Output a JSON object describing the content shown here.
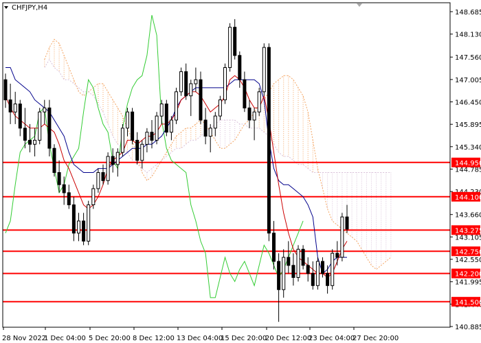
{
  "symbol": {
    "label": "CHFJPY,H4"
  },
  "colors": {
    "bull": "#000000",
    "bear": "#000000",
    "tenkan": "#cc0000",
    "kijun": "#00008b",
    "chikou": "#33cc33",
    "span_a": "#f4a460",
    "span_b": "#d8bfd8",
    "level": "#ff0000",
    "level_label_bg": "#ff0000",
    "axis": "#000000"
  },
  "chart_data": {
    "type": "candlestick",
    "title": "CHFJPY,H4",
    "x_tick_labels": [
      "28 Nov 2022",
      "1 Dec 04:00",
      "5 Dec 20:00",
      "8 Dec 12:00",
      "13 Dec 04:00",
      "15 Dec 20:00",
      "20 Dec 12:00",
      "23 Dec 04:00",
      "27 Dec 20:00"
    ],
    "y_tick_labels": [
      "148.685",
      "148.130",
      "147.560",
      "147.005",
      "146.450",
      "145.895",
      "145.340",
      "144.785",
      "144.230",
      "143.660",
      "143.105",
      "142.550",
      "141.995",
      "141.440",
      "140.885"
    ],
    "ylim": [
      140.885,
      148.685
    ],
    "horizontal_levels": [
      144.95,
      144.1,
      143.275,
      142.75,
      142.2,
      141.5
    ],
    "level_labels": [
      "144.950",
      "144.100",
      "143.275",
      "142.750",
      "142.200",
      "141.500"
    ],
    "current_price_label": "143.275",
    "ohlc": [
      [
        147.0,
        147.15,
        146.3,
        146.5
      ],
      [
        146.5,
        146.9,
        145.9,
        146.2
      ],
      [
        146.2,
        146.7,
        145.9,
        146.4
      ],
      [
        146.4,
        146.5,
        145.6,
        145.8
      ],
      [
        145.8,
        146.3,
        145.3,
        145.5
      ],
      [
        145.5,
        145.9,
        145.2,
        145.4
      ],
      [
        145.4,
        145.8,
        145.1,
        145.5
      ],
      [
        145.5,
        146.3,
        145.4,
        146.2
      ],
      [
        146.2,
        146.5,
        145.9,
        146.3
      ],
      [
        146.3,
        146.5,
        145.1,
        145.3
      ],
      [
        145.3,
        145.4,
        144.6,
        144.7
      ],
      [
        144.7,
        145.0,
        144.2,
        144.4
      ],
      [
        144.4,
        144.6,
        143.9,
        144.2
      ],
      [
        144.2,
        144.4,
        143.8,
        143.9
      ],
      [
        143.9,
        144.1,
        143.0,
        143.2
      ],
      [
        143.2,
        143.7,
        143.0,
        143.5
      ],
      [
        143.5,
        143.7,
        142.9,
        143.0
      ],
      [
        143.0,
        144.0,
        142.9,
        143.9
      ],
      [
        143.9,
        144.4,
        143.8,
        144.3
      ],
      [
        144.3,
        144.8,
        144.2,
        144.7
      ],
      [
        144.7,
        144.9,
        144.4,
        144.5
      ],
      [
        144.5,
        145.2,
        144.4,
        145.1
      ],
      [
        145.1,
        145.3,
        144.7,
        144.9
      ],
      [
        144.9,
        145.3,
        144.6,
        145.2
      ],
      [
        145.2,
        145.9,
        145.1,
        145.8
      ],
      [
        145.8,
        146.3,
        145.6,
        146.2
      ],
      [
        146.2,
        146.3,
        145.4,
        145.5
      ],
      [
        145.5,
        145.7,
        144.9,
        145.0
      ],
      [
        145.0,
        145.5,
        144.8,
        145.4
      ],
      [
        145.4,
        145.8,
        145.2,
        145.7
      ],
      [
        145.7,
        146.0,
        145.3,
        145.5
      ],
      [
        145.5,
        146.2,
        145.4,
        146.1
      ],
      [
        146.1,
        146.5,
        145.9,
        146.4
      ],
      [
        146.4,
        146.5,
        145.6,
        145.7
      ],
      [
        145.7,
        146.1,
        145.5,
        146.0
      ],
      [
        146.0,
        146.8,
        145.9,
        146.7
      ],
      [
        146.7,
        147.3,
        146.6,
        147.2
      ],
      [
        147.2,
        147.4,
        146.5,
        146.6
      ],
      [
        146.6,
        147.0,
        146.1,
        146.9
      ],
      [
        146.9,
        147.3,
        146.7,
        147.0
      ],
      [
        147.0,
        147.2,
        145.9,
        146.0
      ],
      [
        146.0,
        146.3,
        145.4,
        145.6
      ],
      [
        145.6,
        145.9,
        145.2,
        145.8
      ],
      [
        145.8,
        146.2,
        145.6,
        146.1
      ],
      [
        146.1,
        146.6,
        146.0,
        146.5
      ],
      [
        146.5,
        147.4,
        146.4,
        147.3
      ],
      [
        147.3,
        148.4,
        147.2,
        148.3
      ],
      [
        148.3,
        148.5,
        147.5,
        147.6
      ],
      [
        147.6,
        147.7,
        146.8,
        147.0
      ],
      [
        147.0,
        147.2,
        146.2,
        146.3
      ],
      [
        146.3,
        146.5,
        145.8,
        146.0
      ],
      [
        146.0,
        146.3,
        145.5,
        146.2
      ],
      [
        146.2,
        146.8,
        146.1,
        146.7
      ],
      [
        146.7,
        147.9,
        146.6,
        147.8
      ],
      [
        147.8,
        147.9,
        143.0,
        143.2
      ],
      [
        143.2,
        143.5,
        142.3,
        142.5
      ],
      [
        142.5,
        142.7,
        141.0,
        141.8
      ],
      [
        141.8,
        142.8,
        141.6,
        142.6
      ],
      [
        142.6,
        143.0,
        142.2,
        142.4
      ],
      [
        142.4,
        142.7,
        141.9,
        142.1
      ],
      [
        142.1,
        142.9,
        142.0,
        142.8
      ],
      [
        142.8,
        142.9,
        142.3,
        142.4
      ],
      [
        142.4,
        142.6,
        142.0,
        142.2
      ],
      [
        142.2,
        142.5,
        141.8,
        141.9
      ],
      [
        141.9,
        142.6,
        141.8,
        142.5
      ],
      [
        142.5,
        142.6,
        142.1,
        142.2
      ],
      [
        142.2,
        142.4,
        141.7,
        141.9
      ],
      [
        141.9,
        142.8,
        141.8,
        142.7
      ],
      [
        142.7,
        143.0,
        142.4,
        142.6
      ],
      [
        142.6,
        143.7,
        142.5,
        143.6
      ],
      [
        143.6,
        143.9,
        143.2,
        143.3
      ]
    ],
    "tenkan": [
      146.6,
      146.3,
      146.1,
      146.0,
      145.9,
      145.8,
      145.8,
      145.8,
      145.9,
      145.8,
      145.7,
      145.4,
      145.0,
      144.8,
      144.5,
      144.2,
      143.9,
      143.8,
      143.9,
      144.1,
      144.4,
      144.8,
      145.0,
      145.1,
      145.2,
      145.5,
      145.5,
      145.4,
      145.5,
      145.6,
      145.6,
      145.7,
      145.9,
      145.9,
      146.0,
      146.2,
      146.5,
      146.6,
      146.7,
      146.7,
      146.6,
      146.4,
      146.2,
      146.3,
      146.4,
      146.6,
      147.0,
      147.1,
      147.0,
      146.8,
      146.5,
      146.3,
      146.3,
      146.6,
      146.0,
      145.2,
      144.4,
      143.7,
      143.2,
      142.8,
      142.6,
      142.5,
      142.4,
      142.3,
      142.2,
      142.2,
      142.1,
      142.2,
      142.5,
      142.8,
      143.0
    ],
    "kijun": [
      147.3,
      147.3,
      147.0,
      146.9,
      146.8,
      146.7,
      146.5,
      146.4,
      146.3,
      146.2,
      146.0,
      145.8,
      145.6,
      145.2,
      144.9,
      144.8,
      144.7,
      144.7,
      144.7,
      144.8,
      144.8,
      144.8,
      144.9,
      145.0,
      145.1,
      145.2,
      145.3,
      145.3,
      145.3,
      145.4,
      145.4,
      145.5,
      145.6,
      145.8,
      146.0,
      146.3,
      146.5,
      146.6,
      146.7,
      146.8,
      146.8,
      146.8,
      146.8,
      146.8,
      146.8,
      146.8,
      146.9,
      147.0,
      147.0,
      147.0,
      147.0,
      147.0,
      146.9,
      146.5,
      145.5,
      144.8,
      144.5,
      144.4,
      144.4,
      144.3,
      144.2,
      144.1,
      143.9,
      143.6,
      142.6,
      142.2,
      142.3,
      142.5,
      142.6,
      142.6,
      142.6
    ],
    "chikou": [
      143.2,
      143.5,
      144.4,
      145.2,
      145.4,
      145.5,
      145.6,
      146.2,
      146.3,
      145.4,
      144.8,
      144.2,
      144.4,
      144.9,
      145.1,
      145.3,
      146.2,
      147.0,
      146.8,
      146.3,
      145.9,
      145.7,
      145.0,
      144.8,
      145.8,
      146.4,
      146.8,
      147.0,
      147.1,
      147.6,
      148.6,
      148.1,
      146.0,
      145.3,
      145.0,
      144.9,
      144.8,
      144.7,
      143.9,
      143.5,
      143.0,
      142.7,
      141.6,
      141.6,
      142.1,
      142.6,
      142.2,
      142.0,
      142.3,
      142.5,
      142.2,
      141.9,
      142.4,
      142.9,
      142.7,
      142.4,
      142.1,
      142.3,
      142.6,
      142.9,
      143.2,
      143.5
    ],
    "span_a": [
      147.5,
      147.8,
      148.0,
      147.9,
      147.6,
      147.3,
      147.0,
      146.7,
      146.6,
      146.7,
      146.8,
      146.9,
      146.9,
      146.7,
      146.5,
      146.3,
      146.1,
      145.8,
      145.5,
      145.1,
      144.7,
      144.5,
      144.6,
      144.8,
      145.0,
      145.2,
      145.4,
      145.6,
      145.7,
      145.8,
      145.8,
      145.9,
      146.0,
      145.9,
      145.7,
      145.5,
      145.3,
      145.3,
      145.4,
      145.5,
      145.7,
      145.9,
      146.0,
      146.2,
      146.4,
      146.5,
      146.7,
      146.9,
      147.0,
      147.1,
      147.1,
      147.0,
      146.8,
      146.6,
      146.2,
      145.5,
      144.8,
      144.3,
      143.8,
      143.5,
      143.4,
      143.3,
      143.2,
      143.1,
      143.0,
      142.8,
      142.6,
      142.4,
      142.3,
      142.4,
      142.5,
      142.6
    ],
    "span_b": [
      147.3,
      147.5,
      147.3,
      147.2,
      147.0,
      147.0,
      146.9,
      146.8,
      146.7,
      146.7,
      146.6,
      146.4,
      146.2,
      145.9,
      145.6,
      145.4,
      145.3,
      145.2,
      145.0,
      144.9,
      144.8,
      144.7,
      144.8,
      144.9,
      145.0,
      145.1,
      145.2,
      145.3,
      145.3,
      145.4,
      145.5,
      145.5,
      145.6,
      145.7,
      145.8,
      145.9,
      146.0,
      146.0,
      146.0,
      146.0,
      145.9,
      145.9,
      145.8,
      145.8,
      145.8,
      145.7,
      145.6,
      145.4,
      145.2,
      145.1,
      145.1,
      145.0,
      144.9,
      144.9,
      144.8,
      144.7,
      144.7,
      144.7,
      144.7,
      144.7,
      144.7,
      144.7,
      144.7,
      144.7,
      144.7,
      144.7,
      144.7,
      144.7,
      144.7,
      144.7,
      144.7,
      144.7
    ]
  }
}
